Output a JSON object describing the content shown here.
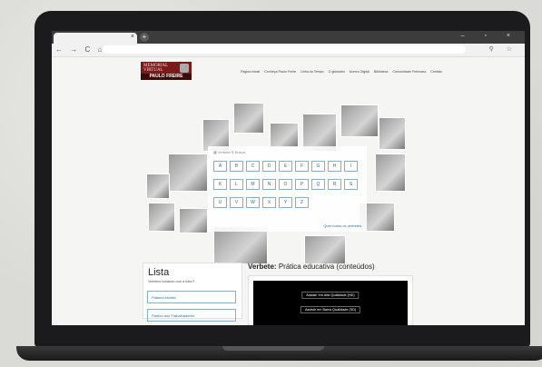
{
  "browser": {
    "tab_close": "×",
    "new_tab": "+",
    "window_controls": "– ▫ ×",
    "nav_buttons": "← → C ⌂",
    "addr_icons": "⚲ ☆"
  },
  "logo": {
    "line1": "MEMORIAL",
    "line2": "VIRTUAL",
    "name": "PAULO FREIRE"
  },
  "menu": [
    "Página inicial",
    "Conheça Paulo Freire",
    "Linha do Tempo",
    "O glossário",
    "Acervo Digital",
    "Biblioteca",
    "Comunidade Freireana",
    "Contato"
  ],
  "search": {
    "tab1": "Verbete",
    "tab2": "Busca"
  },
  "letters_row1": [
    "A",
    "B",
    "C",
    "D",
    "E",
    "F",
    "G",
    "H",
    "I",
    "J"
  ],
  "letters_row2": [
    "K",
    "L",
    "M",
    "N",
    "O",
    "P",
    "Q",
    "R",
    "S",
    "T"
  ],
  "letters_row3": [
    "U",
    "V",
    "W",
    "X",
    "Y",
    "Z"
  ],
  "view_all_link": "Quer todos os verbetes",
  "sidebar": {
    "title": "Lista",
    "subtitle": "Verbetes iniciando com a letra P",
    "items": [
      "Palavra escrita",
      "Partido dos Trabalhadores"
    ]
  },
  "verbete": {
    "prefix": "Verbete:",
    "title": "Prática educativa (conteúdos)"
  },
  "video": {
    "hq_button": "Assistir em Alta Qualidade (HD)",
    "lq_button": "Assistir em Baixa Qualidade (SD)"
  }
}
